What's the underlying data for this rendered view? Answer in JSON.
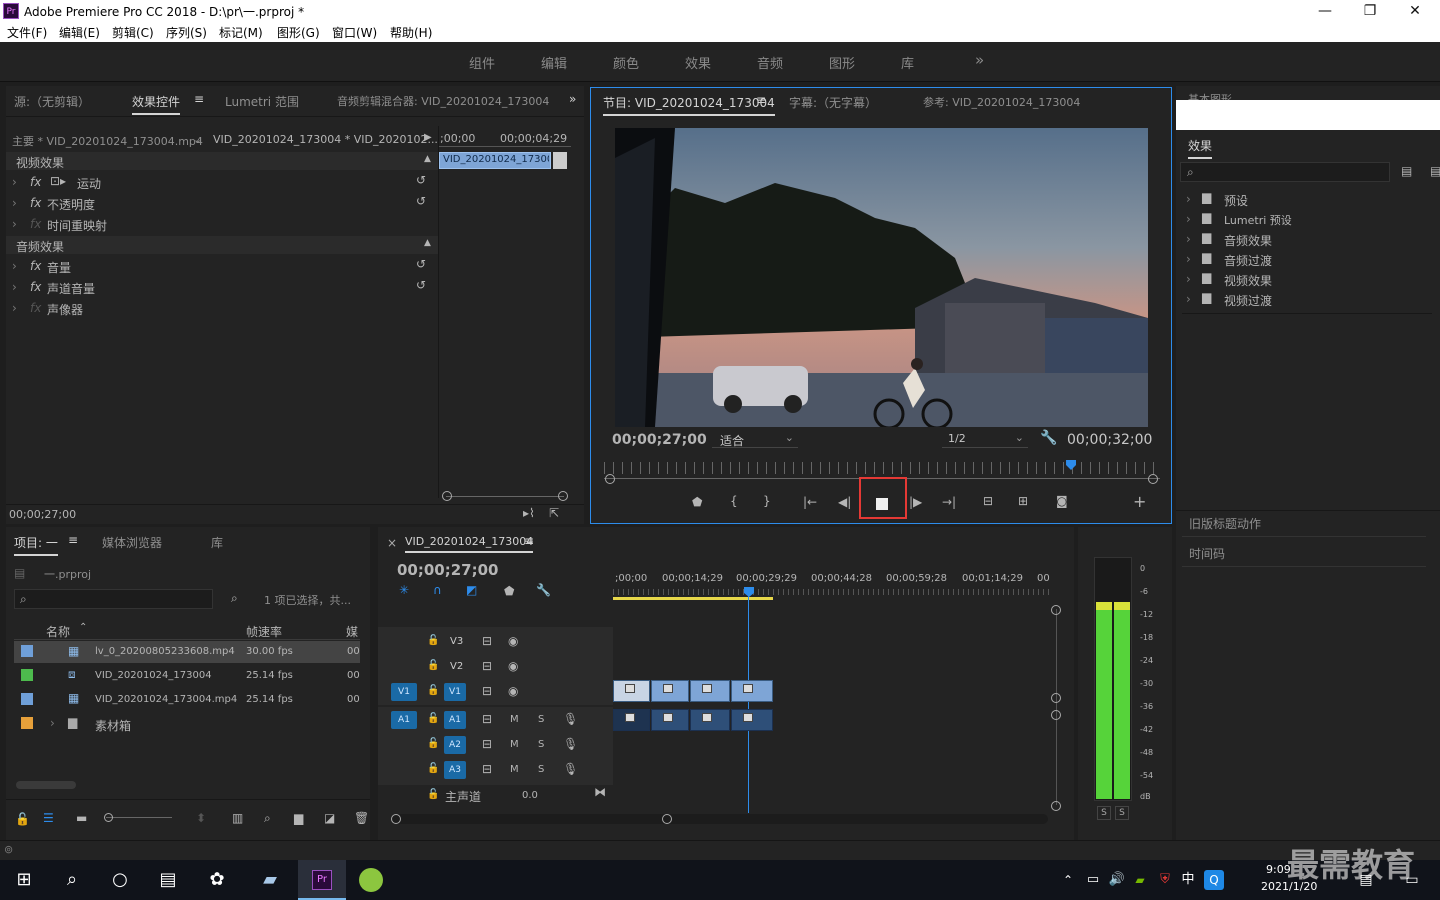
{
  "window": {
    "app_icon": "Pr",
    "title": "Adobe Premiere Pro CC 2018 - D:\\pr\\一.prproj *",
    "controls": [
      "—",
      "❐",
      "✕"
    ]
  },
  "menu": [
    "文件(F)",
    "编辑(E)",
    "剪辑(C)",
    "序列(S)",
    "标记(M)",
    "图形(G)",
    "窗口(W)",
    "帮助(H)"
  ],
  "workspaces": [
    "组件",
    "编辑",
    "颜色",
    "效果",
    "音频",
    "图形",
    "库"
  ],
  "workspace_more": "»",
  "effect_controls": {
    "tabs": [
      "源:（无剪辑）",
      "效果控件",
      "Lumetri 范围",
      "音频剪辑混合器: VID_20201024_173004"
    ],
    "overflow": "»",
    "master_label": "主要 * VID_20201024_173004.mp4",
    "sequence_label": "VID_20201024_173004 * VID_2020102...",
    "ruler_start": ";00;00",
    "ruler_end": "00;00;04;29",
    "mini_clip": "VID_20201024_173004",
    "video_section": "视频效果",
    "video_effects": [
      "运动",
      "不透明度",
      "时间重映射"
    ],
    "audio_section": "音频效果",
    "audio_effects": [
      "音量",
      "声道音量",
      "声像器"
    ],
    "fx_glyph": "fx",
    "reset_glyph": "↺",
    "timecode": "00;00;27;00"
  },
  "program": {
    "tabs": [
      "节目: VID_20201024_173004",
      "字幕:（无字幕）",
      "参考: VID_20201024_173004"
    ],
    "menu_glyph": "≡",
    "timecode": "00;00;27;00",
    "fit": "适合",
    "resolution": "1/2",
    "duration": "00;00;32;00",
    "playhead_fraction": 0.84,
    "transport": [
      "marker-icon",
      "in-point-icon",
      "out-point-icon",
      "go-to-in-icon",
      "step-back-icon",
      "stop-icon",
      "step-forward-icon",
      "go-to-out-icon",
      "lift-icon",
      "extract-icon",
      "export-frame-icon",
      "add-icon"
    ]
  },
  "effects": {
    "header_label": "基本图形",
    "tab": "效果",
    "folders": [
      "预设",
      "Lumetri 预设",
      "音频效果",
      "音频过渡",
      "视频效果",
      "视频过渡"
    ],
    "legacy_title": "旧版标题动作",
    "timecode_panel": "时间码"
  },
  "project": {
    "tabs": [
      "项目: 一",
      "媒体浏览器",
      "库"
    ],
    "file": "一.prproj",
    "selection_info": "1 项已选择，共...",
    "columns": [
      "名称",
      "帧速率",
      "媒"
    ],
    "items": [
      {
        "name": "lv_0_20200805233608.mp4",
        "fps": "30.00 fps",
        "media": "00",
        "color": "#6f9fd8"
      },
      {
        "name": "VID_20201024_173004",
        "fps": "25.14 fps",
        "media": "00",
        "color": "#4dbb4d"
      },
      {
        "name": "VID_20201024_173004.mp4",
        "fps": "25.14 fps",
        "media": "00",
        "color": "#6f9fd8"
      },
      {
        "name": "素材箱",
        "fps": "",
        "media": "",
        "color": "#e6a03a"
      }
    ]
  },
  "timeline": {
    "sequence": "VID_20201024_173004",
    "close": "×",
    "timecode": "00;00;27;00",
    "ruler": [
      ";00;00",
      "00;00;14;29",
      "00;00;29;29",
      "00;00;44;28",
      "00;00;59;28",
      "00;01;14;29",
      "00"
    ],
    "video_tracks": [
      "V3",
      "V2",
      "V1"
    ],
    "audio_tracks": [
      "A1",
      "A2",
      "A3"
    ],
    "source_v": "V1",
    "source_a": "A1",
    "master_label": "主声道",
    "master_value": "0.0",
    "mute": "M",
    "solo": "S"
  },
  "meters": {
    "scale": [
      "0",
      "-6",
      "-12",
      "-18",
      "-24",
      "-30",
      "-36",
      "-42",
      "-48",
      "-54",
      "dB"
    ],
    "solo": [
      "S",
      "S"
    ],
    "level_fraction": 0.82
  },
  "taskbar": {
    "time": "9:09",
    "date": "2021/1/20",
    "ime": "中",
    "watermark": "最需教育"
  }
}
